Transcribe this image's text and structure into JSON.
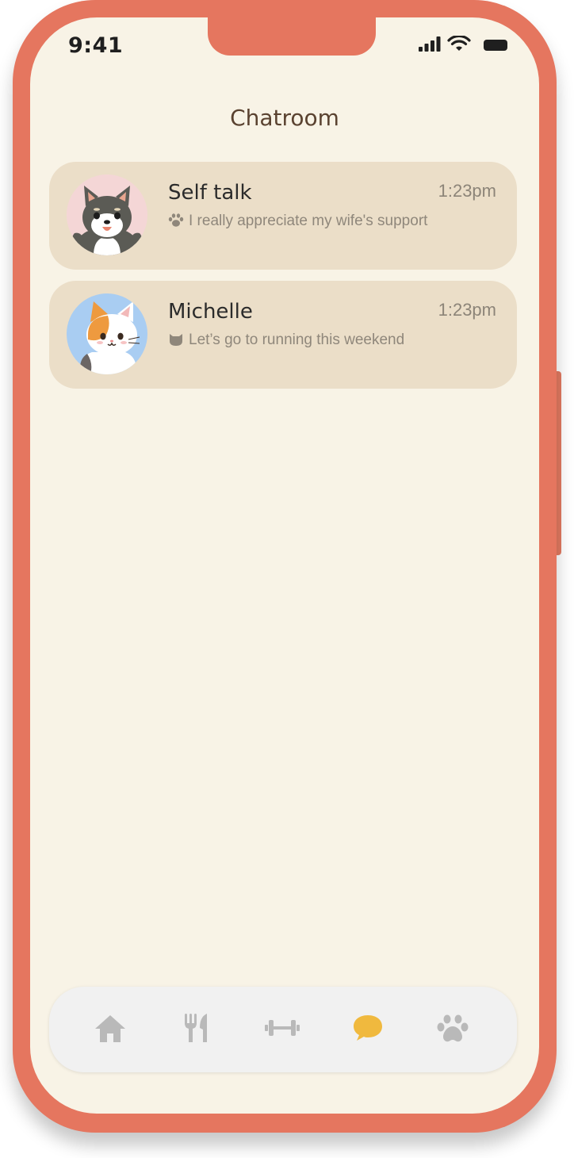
{
  "status_bar": {
    "time": "9:41"
  },
  "page": {
    "title": "Chatroom"
  },
  "chats": [
    {
      "name": "Self talk",
      "time": "1:23pm",
      "preview": "I really appreciate my wife's support",
      "preview_icon": "paw-icon",
      "avatar": "shiba-dog-avatar",
      "avatar_bg": "#f4d6d6"
    },
    {
      "name": "Michelle",
      "time": "1:23pm",
      "preview": "Let’s go to running this weekend",
      "preview_icon": "cat-head-icon",
      "avatar": "calico-cat-avatar",
      "avatar_bg": "#a9cdf2"
    }
  ],
  "tabbar": {
    "items": [
      {
        "icon": "home-icon",
        "active": false
      },
      {
        "icon": "fork-knife-icon",
        "active": false
      },
      {
        "icon": "dumbbell-icon",
        "active": false
      },
      {
        "icon": "chat-bubble-icon",
        "active": true
      },
      {
        "icon": "paw-icon",
        "active": false
      }
    ],
    "active_color": "#f0b93e",
    "inactive_color": "#b9b9b9"
  },
  "colors": {
    "frame": "#e5765f",
    "screen_bg": "#f8f3e6",
    "card_bg": "#ebdec8",
    "title": "#5a4230"
  }
}
